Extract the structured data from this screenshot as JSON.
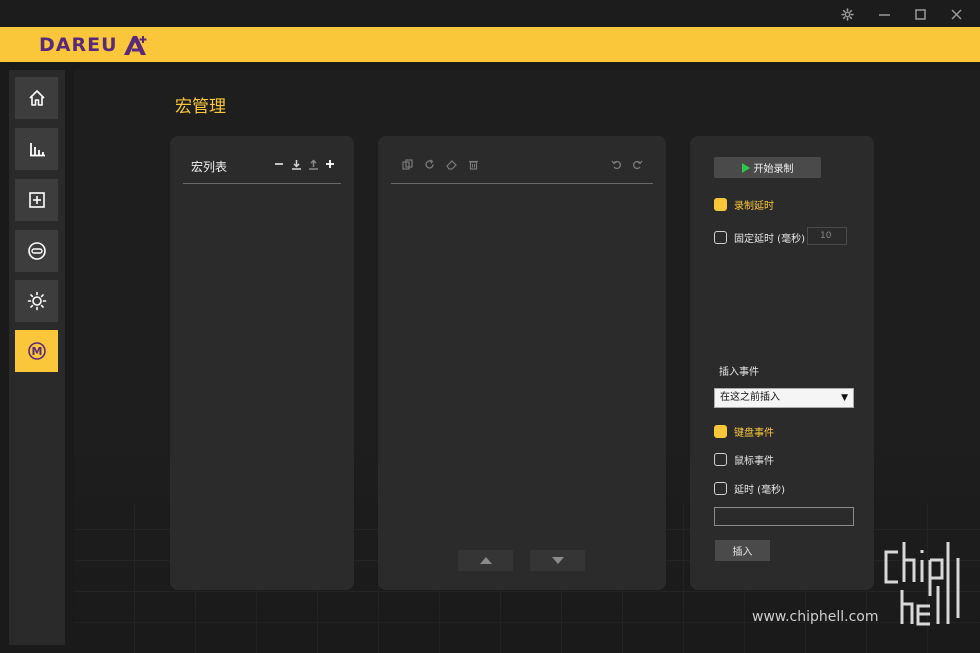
{
  "window": {
    "settings_icon": "gear-icon",
    "minimize_icon": "minimize-icon",
    "maximize_icon": "maximize-icon",
    "close_icon": "close-icon"
  },
  "brand": {
    "logo_text": "DAREU",
    "accent_color": "#fbc73a",
    "logo_color": "#5a2a7a"
  },
  "sidebar": {
    "items": [
      {
        "icon": "home-icon",
        "active": false
      },
      {
        "icon": "bar-chart-icon",
        "active": false
      },
      {
        "icon": "plus-square-icon",
        "active": false
      },
      {
        "icon": "link-icon",
        "active": false
      },
      {
        "icon": "brightness-icon",
        "active": false
      },
      {
        "icon": "macro-icon",
        "label": "M",
        "active": true
      }
    ]
  },
  "page": {
    "title": "宏管理"
  },
  "macro_list": {
    "title": "宏列表",
    "toolbar_icons": [
      "minus-icon",
      "import-icon",
      "export-icon",
      "plus-icon"
    ]
  },
  "editor": {
    "toolbar_left_icons": [
      "copy-icon",
      "refresh-icon",
      "eraser-icon",
      "trash-icon"
    ],
    "toolbar_right_icons": [
      "undo-icon",
      "redo-icon"
    ],
    "move_up_icon": "arrow-up-icon",
    "move_down_icon": "arrow-down-icon"
  },
  "record": {
    "start_label": "开始录制",
    "record_delay_label": "录制延时",
    "record_delay_checked": true,
    "fixed_delay_label": "固定延时 (毫秒)",
    "fixed_delay_checked": false,
    "fixed_delay_value": "10"
  },
  "insert": {
    "section_label": "插入事件",
    "position_select": "在这之前插入",
    "keyboard_label": "键盘事件",
    "keyboard_checked": true,
    "mouse_label": "鼠标事件",
    "mouse_checked": false,
    "delay_label": "延时 (毫秒)",
    "delay_checked": false,
    "delay_value": "",
    "insert_button": "插入"
  },
  "watermark": {
    "url_text": "www.chiphell.com",
    "logo_text": "chiphell"
  }
}
